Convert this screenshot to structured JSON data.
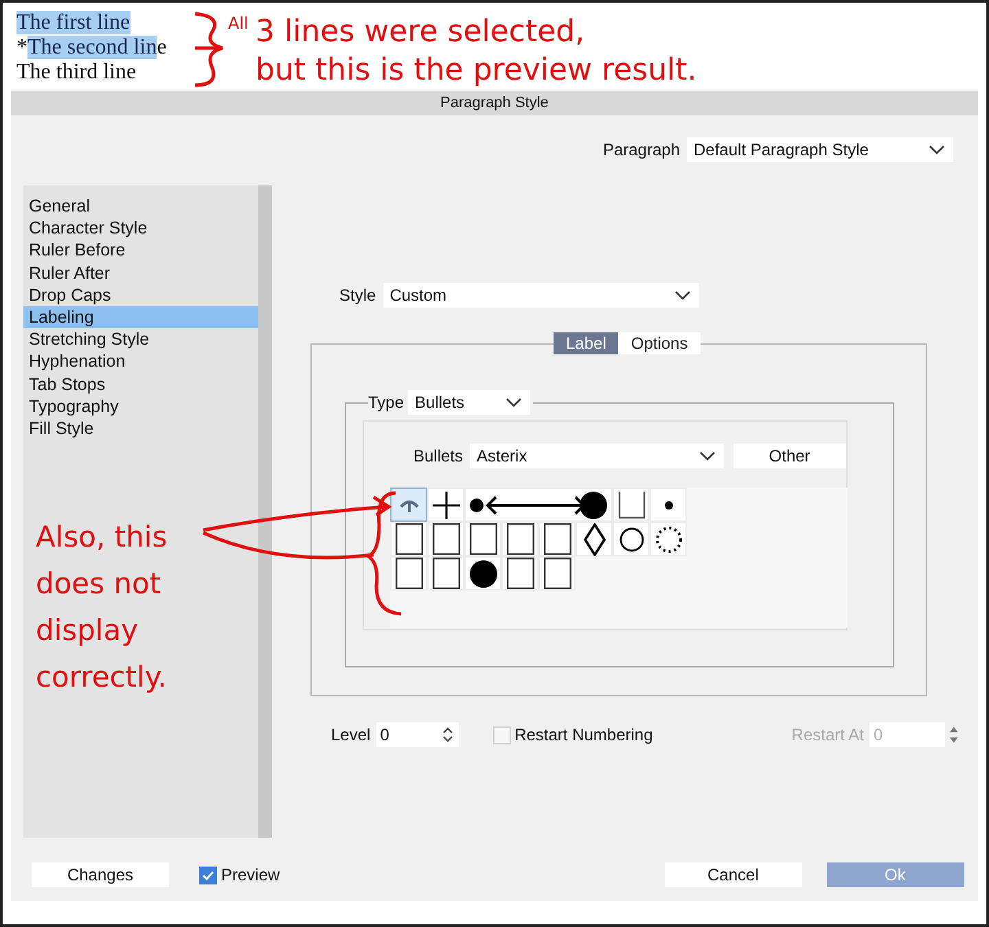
{
  "document": {
    "lines": [
      [
        {
          "text": "The first line",
          "selected": true
        }
      ],
      [
        {
          "text": "*",
          "selected": false
        },
        {
          "text": "The second lin",
          "selected": true
        },
        {
          "text": "e",
          "selected": false
        }
      ],
      [
        {
          "text": "The third line",
          "selected": false
        }
      ]
    ]
  },
  "annotations": {
    "top": {
      "superscript": "All",
      "lines": [
        "3 lines were selected,",
        "but this is the preview result."
      ]
    },
    "left": {
      "lines": [
        "Also, this",
        "does not",
        "display",
        "correctly."
      ]
    }
  },
  "dialog": {
    "title": "Paragraph Style",
    "paragraph": {
      "label": "Paragraph",
      "value": "Default Paragraph Style"
    },
    "categories": [
      {
        "label": "General",
        "selected": false
      },
      {
        "label": "Character Style",
        "selected": false
      },
      {
        "label": "Ruler Before",
        "selected": false
      },
      {
        "label": "Ruler After",
        "selected": false
      },
      {
        "label": "Drop Caps",
        "selected": false
      },
      {
        "label": "Labeling",
        "selected": true
      },
      {
        "label": "Stretching Style",
        "selected": false
      },
      {
        "label": "Hyphenation",
        "selected": false
      },
      {
        "label": "Tab Stops",
        "selected": false
      },
      {
        "label": "Typography",
        "selected": false
      },
      {
        "label": "Fill Style",
        "selected": false
      }
    ],
    "style": {
      "label": "Style",
      "value": "Custom"
    },
    "tabs": [
      {
        "label": "Label",
        "selected": true
      },
      {
        "label": "Options",
        "selected": false
      }
    ],
    "type": {
      "label": "Type",
      "value": "Bullets"
    },
    "bullets": {
      "label": "Bullets",
      "value": "Asterix"
    },
    "other_button": "Other",
    "bullet_grid": [
      [
        {
          "kind": "asterisk",
          "selected": true
        },
        {
          "kind": "plus",
          "selected": false
        },
        {
          "kind": "dot-arrow-dot",
          "selected": false
        },
        {
          "kind": "square-cut",
          "selected": false
        },
        {
          "kind": "small-dot",
          "selected": false
        }
      ],
      [
        {
          "kind": "square",
          "selected": false
        },
        {
          "kind": "square",
          "selected": false
        },
        {
          "kind": "square",
          "selected": false
        },
        {
          "kind": "square",
          "selected": false
        },
        {
          "kind": "square",
          "selected": false
        },
        {
          "kind": "diamond",
          "selected": false
        },
        {
          "kind": "circle",
          "selected": false
        },
        {
          "kind": "dotted-circle",
          "selected": false
        }
      ],
      [
        {
          "kind": "square",
          "selected": false
        },
        {
          "kind": "square",
          "selected": false
        },
        {
          "kind": "filled-circle",
          "selected": false
        },
        {
          "kind": "square",
          "selected": false
        },
        {
          "kind": "square",
          "selected": false
        }
      ]
    ],
    "level": {
      "label": "Level",
      "value": "0"
    },
    "restart_numbering": {
      "label": "Restart Numbering",
      "checked": false
    },
    "restart_at": {
      "label": "Restart At",
      "value": "0",
      "disabled": true
    },
    "changes_button": "Changes",
    "preview": {
      "label": "Preview",
      "checked": true
    },
    "cancel_button": "Cancel",
    "ok_button": "Ok"
  }
}
